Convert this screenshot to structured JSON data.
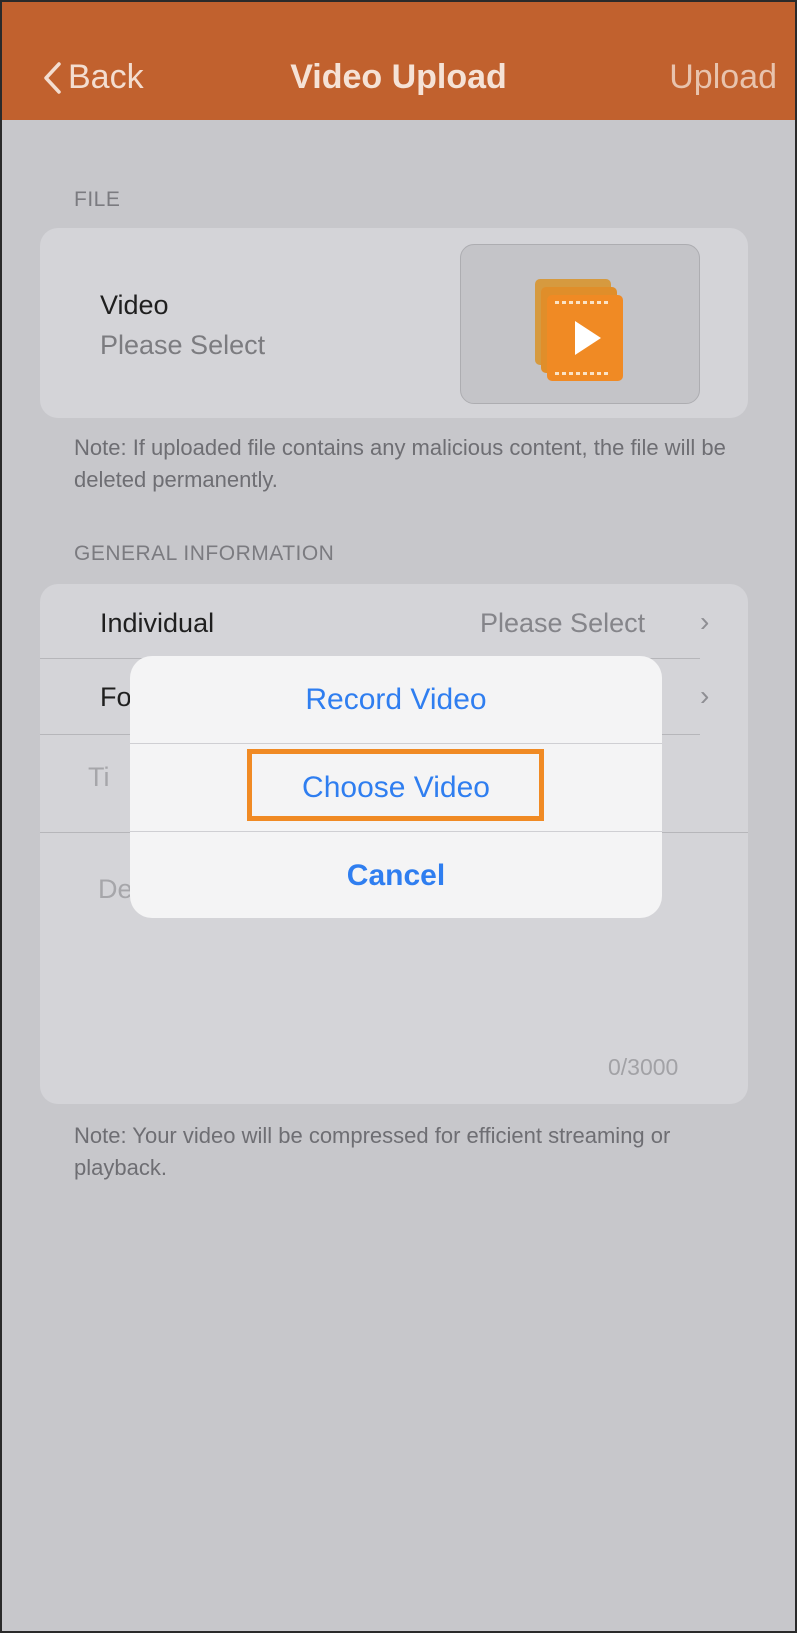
{
  "navbar": {
    "back_label": "Back",
    "title": "Video Upload",
    "upload_label": "Upload"
  },
  "file_section": {
    "header": "FILE",
    "video_label": "Video",
    "video_value": "Please Select",
    "thumbnail_icon": "video-files-icon",
    "note": "Note: If uploaded file contains any malicious content, the file will be deleted permanently."
  },
  "general_section": {
    "header": "GENERAL INFORMATION",
    "individual_label": "Individual",
    "individual_value": "Please Select",
    "folder_label_partial": "Fo",
    "title_placeholder_partial": "Ti",
    "description_placeholder_partial": "De",
    "char_counter": "0/3000",
    "note": "Note: Your video will be compressed for efficient streaming or playback."
  },
  "action_sheet": {
    "record_label": "Record Video",
    "choose_label": "Choose Video",
    "cancel_label": "Cancel"
  },
  "colors": {
    "navbar": "#c1612e",
    "accent_blue": "#2f7ef0",
    "highlight": "#f08a24"
  }
}
